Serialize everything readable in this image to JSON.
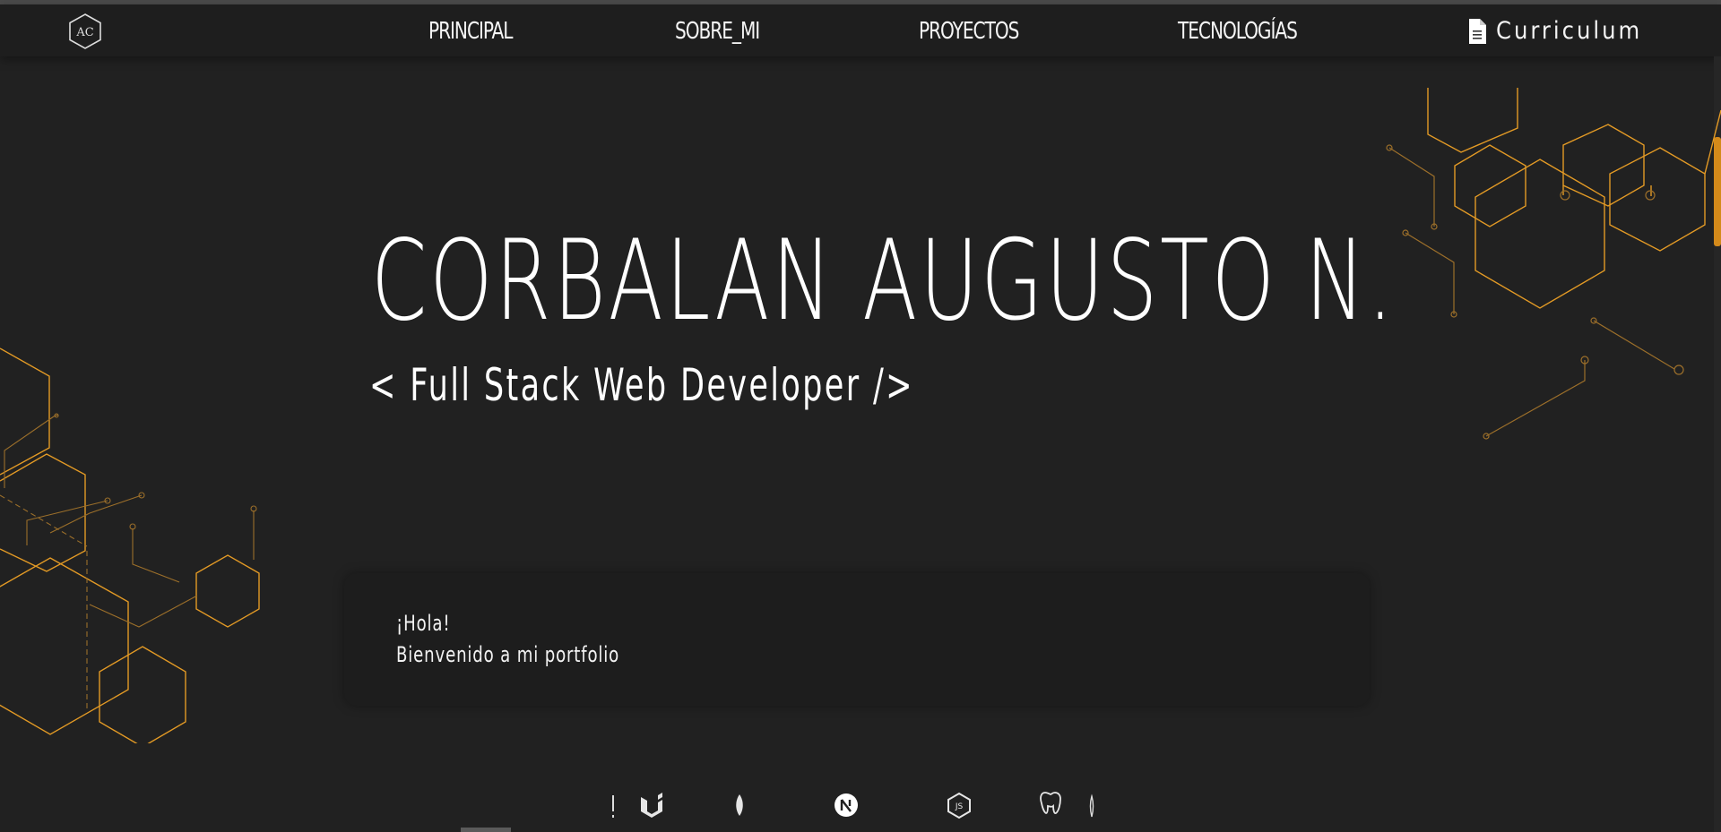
{
  "nav": {
    "logo_text": "AC",
    "items": [
      {
        "label": "PRINCIPAL"
      },
      {
        "label": "SOBRE_MI"
      },
      {
        "label": "PROYECTOS"
      },
      {
        "label": "TECNOLOGÍAS"
      }
    ],
    "cv_label": "Curriculum",
    "cv_icon": "document-icon"
  },
  "hero": {
    "name": "CORBALAN AUGUSTO N.",
    "role": "< Full Stack Web Developer />"
  },
  "welcome": {
    "line1": "¡Hola!",
    "line2": "Bienvenido a mi portfolio"
  },
  "tech_icons": [
    "material-ui-icon",
    "mongodb-icon",
    "nextjs-icon",
    "nodejs-icon",
    "postgresql-icon"
  ],
  "colors": {
    "background": "#212121",
    "navbar": "#1e1e1e",
    "accent": "#e39a25",
    "text": "#ffffff"
  }
}
